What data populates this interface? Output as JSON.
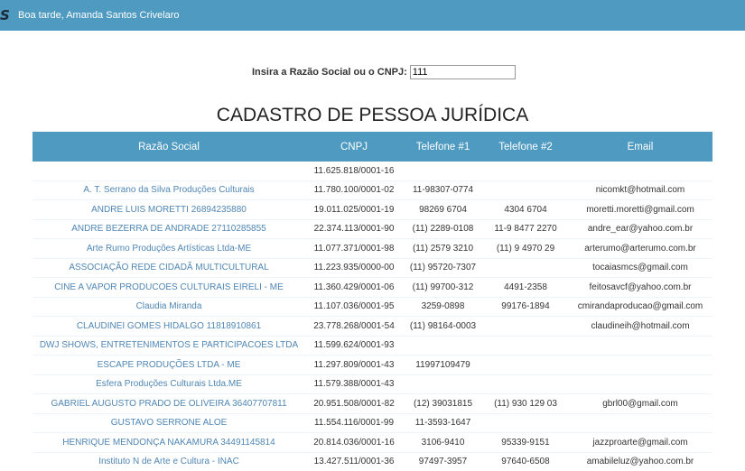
{
  "header": {
    "logo": "S",
    "greeting": "Boa tarde, Amanda Santos Crivelaro"
  },
  "search": {
    "label": "Insira a Razão Social ou o CNPJ:",
    "value": "111"
  },
  "page_title": "CADASTRO DE PESSOA JURÍDICA",
  "table": {
    "headers": [
      "Razão Social",
      "CNPJ",
      "Telefone #1",
      "Telefone #2",
      "Email"
    ],
    "rows": [
      [
        "",
        "11.625.818/0001-16",
        "",
        "",
        ""
      ],
      [
        "A. T. Serrano da Silva Produções Culturais",
        "11.780.100/0001-02",
        "11-98307-0774",
        "",
        "nicomkt@hotmail.com"
      ],
      [
        "ANDRE LUIS MORETTI 26894235880",
        "19.011.025/0001-19",
        "98269 6704",
        "4304 6704",
        "moretti.moretti@gmail.com"
      ],
      [
        "ANDRE BEZERRA DE ANDRADE 27110285855",
        "22.374.113/0001-90",
        "(11) 2289-0108",
        "11-9 8477 2270",
        "andre_ear@yahoo.com.br"
      ],
      [
        "Arte Rumo Produções Artísticas Ltda-ME",
        "11.077.371/0001-98",
        "(11) 2579 3210",
        "(11) 9 4970 29",
        "arterumo@arterumo.com.br"
      ],
      [
        "ASSOCIAÇÃO REDE CIDADÃ MULTICULTURAL",
        "11.223.935/0000-00",
        "(11) 95720-7307",
        "",
        "tocaiasmcs@gmail.com"
      ],
      [
        "CINE A VAPOR PRODUCOES CULTURAIS EIRELI - ME",
        "11.360.429/0001-06",
        "(11) 99700-312",
        "4491-2358",
        "feitosavcf@yahoo.com.br"
      ],
      [
        "Claudia Miranda",
        "11.107.036/0001-95",
        "3259-0898",
        "99176-1894",
        "cmirandaproducao@gmail.com"
      ],
      [
        "CLAUDINEI GOMES HIDALGO 11818910861",
        "23.778.268/0001-54",
        "(11) 98164-0003",
        "",
        "claudineih@hotmail.com"
      ],
      [
        "DWJ SHOWS, ENTRETENIMENTOS E PARTICIPACOES LTDA",
        "11.599.624/0001-93",
        "",
        "",
        ""
      ],
      [
        "ESCAPE PRODUÇÕES LTDA - ME",
        "11.297.809/0001-43",
        "11997109479",
        "",
        ""
      ],
      [
        "Esfera Produções Culturais Ltda.ME",
        "11.579.388/0001-43",
        "",
        "",
        ""
      ],
      [
        "GABRIEL AUGUSTO PRADO DE OLIVEIRA 36407707811",
        "20.951.508/0001-82",
        "(12) 39031815",
        "(11) 930 129 03",
        "gbrl00@gmail.com"
      ],
      [
        "GUSTAVO SERRONE ALOE",
        "11.554.116/0001-99",
        "11-3593-1647",
        "",
        ""
      ],
      [
        "HENRIQUE MENDONÇA NAKAMURA 34491145814",
        "20.814.036/0001-16",
        "3106-9410",
        "95339-9151",
        "jazzproarte@gmail.com"
      ],
      [
        "Instituto N de Arte e Cultura - INAC",
        "13.427.511/0001-36",
        "97497-3957",
        "97640-6508",
        "amabileluz@yahoo.com.br"
      ]
    ]
  }
}
